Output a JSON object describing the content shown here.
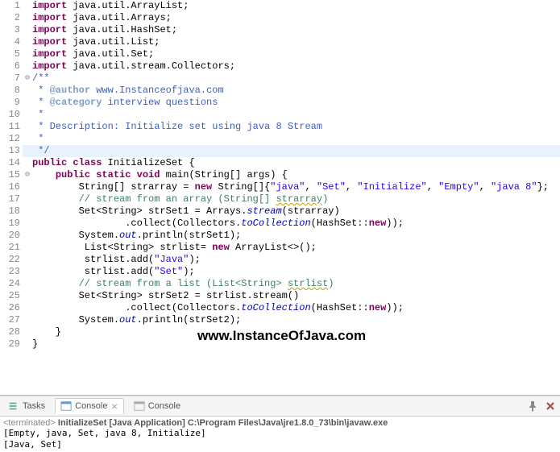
{
  "code": {
    "lines": [
      {
        "n": 1,
        "fold": "",
        "html": "<span class='kw'>import</span> java.util.ArrayList;"
      },
      {
        "n": 2,
        "fold": "",
        "html": "<span class='kw'>import</span> java.util.Arrays;"
      },
      {
        "n": 3,
        "fold": "",
        "html": "<span class='kw'>import</span> java.util.HashSet;"
      },
      {
        "n": 4,
        "fold": "",
        "html": "<span class='kw'>import</span> java.util.List;"
      },
      {
        "n": 5,
        "fold": "",
        "html": "<span class='kw'>import</span> java.util.Set;"
      },
      {
        "n": 6,
        "fold": "",
        "html": "<span class='kw'>import</span> java.util.stream.Collectors;"
      },
      {
        "n": 7,
        "fold": "⊖",
        "html": "<span class='doc'>/**</span>"
      },
      {
        "n": 8,
        "fold": "",
        "html": "<span class='doc'> * <span class='doctag'>@author</span> www.Instanceofjava.com</span>"
      },
      {
        "n": 9,
        "fold": "",
        "html": "<span class='doc'> * <span class='doctag'>@category</span> interview questions</span>"
      },
      {
        "n": 10,
        "fold": "",
        "html": "<span class='doc'> *</span>"
      },
      {
        "n": 11,
        "fold": "",
        "html": "<span class='doc'> * Description: Initialize set using java 8 Stream</span>"
      },
      {
        "n": 12,
        "fold": "",
        "html": "<span class='doc'> *</span>"
      },
      {
        "n": 13,
        "fold": "",
        "highlight": true,
        "html": "<span class='doc'> */</span>"
      },
      {
        "n": 14,
        "fold": "",
        "html": "<span class='kw'>public class</span> InitializeSet {"
      },
      {
        "n": 15,
        "fold": "⊖",
        "html": "    <span class='kw'>public static void</span> main(String[] args) {"
      },
      {
        "n": 16,
        "fold": "",
        "html": "        String[] strarray = <span class='kw'>new</span> String[]{<span class='str'>\"java\"</span>, <span class='str'>\"Set\"</span>, <span class='str'>\"Initialize\"</span>, <span class='str'>\"Empty\"</span>, <span class='str'>\"java 8\"</span>};"
      },
      {
        "n": 17,
        "fold": "",
        "html": "        <span class='com'>// stream from an array (String[] <span class='wavy'>strarray</span>)</span>"
      },
      {
        "n": 18,
        "fold": "",
        "html": "        Set&lt;String&gt; strSet1 = Arrays.<span class='static'>stream</span>(strarray)"
      },
      {
        "n": 19,
        "fold": "",
        "html": "                .collect(Collectors.<span class='static'>toCollection</span>(HashSet::<span class='kw'>new</span>));"
      },
      {
        "n": 20,
        "fold": "",
        "html": "        System.<span class='static'>out</span>.println(strSet1);"
      },
      {
        "n": 21,
        "fold": "",
        "html": "         List&lt;String&gt; strlist= <span class='kw'>new</span> ArrayList&lt;&gt;();"
      },
      {
        "n": 22,
        "fold": "",
        "html": "         strlist.add(<span class='str'>\"Java\"</span>);"
      },
      {
        "n": 23,
        "fold": "",
        "html": "         strlist.add(<span class='str'>\"Set\"</span>);"
      },
      {
        "n": 24,
        "fold": "",
        "html": "        <span class='com'>// stream from a list (List&lt;String&gt; <span class='wavy'>strlist</span>)</span>"
      },
      {
        "n": 25,
        "fold": "",
        "html": "        Set&lt;String&gt; strSet2 = strlist.stream()"
      },
      {
        "n": 26,
        "fold": "",
        "html": "                .collect(Collectors.<span class='static'>toCollection</span>(HashSet::<span class='kw'>new</span>));"
      },
      {
        "n": 27,
        "fold": "",
        "html": "        System.<span class='static'>out</span>.println(strSet2);"
      },
      {
        "n": 28,
        "fold": "",
        "html": "    }"
      },
      {
        "n": 29,
        "fold": "",
        "html": "}"
      }
    ]
  },
  "watermark": "www.InstanceOfJava.com",
  "tabs": {
    "tasks": "Tasks",
    "console_active": "Console",
    "console_close_icon": "⨯",
    "console_other": "Console"
  },
  "console": {
    "status_prefix": "<terminated>",
    "launch": "InitializeSet [Java Application] C:\\Program Files\\Java\\jre1.8.0_73\\bin\\javaw.exe",
    "lines": [
      "[Empty, java, Set, java 8, Initialize]",
      "[Java, Set]"
    ]
  },
  "toolbar": {
    "pin": "📌",
    "close": "✖"
  }
}
